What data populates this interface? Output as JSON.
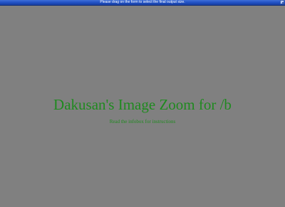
{
  "window": {
    "title": "Please drag on the form to select the final output size."
  },
  "content": {
    "heading": "Dakusan's Image Zoom for /b",
    "subtext": "Read the infobox for instructions"
  },
  "colors": {
    "background": "#808080",
    "text_green": "#1f8a1f",
    "title_bar": "#1f4fc2"
  }
}
